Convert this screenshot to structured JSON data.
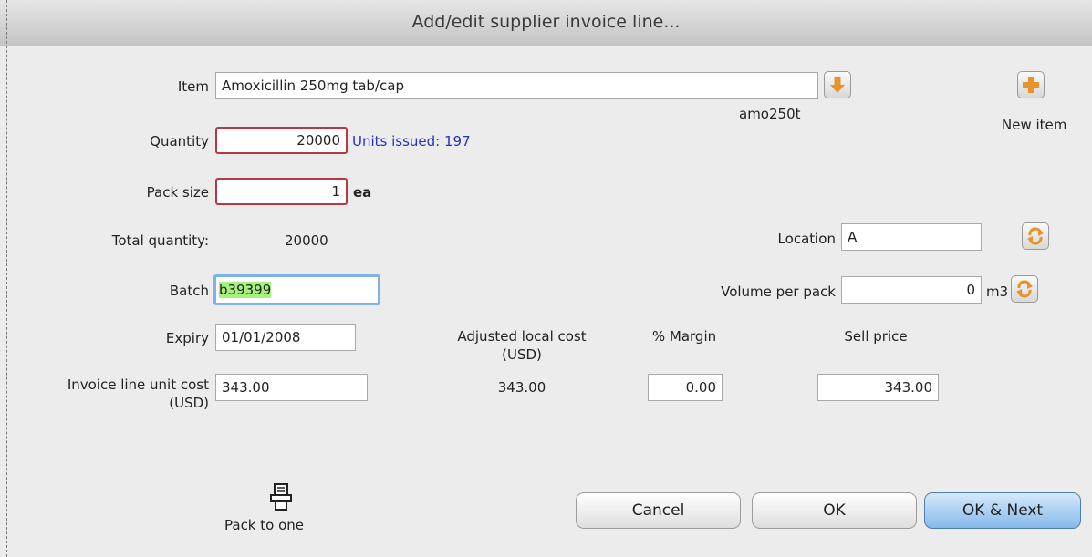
{
  "window": {
    "title": "Add/edit supplier invoice line..."
  },
  "item": {
    "label": "Item",
    "value": "Amoxicillin 250mg tab/cap",
    "code": "amo250t",
    "new_item_label": "New item",
    "dropdown_icon": "arrow-down-icon",
    "new_item_icon": "plus-icon"
  },
  "quantity": {
    "label": "Quantity",
    "value": "20000",
    "units_issued": "Units issued: 197"
  },
  "pack_size": {
    "label": "Pack size",
    "value": "1",
    "unit": "ea"
  },
  "total_quantity": {
    "label": "Total quantity:",
    "value": "20000"
  },
  "location": {
    "label": "Location",
    "value": "A",
    "icon": "cycle-icon"
  },
  "batch": {
    "label": "Batch",
    "value": "b39399"
  },
  "volume": {
    "label": "Volume per pack",
    "value": "0",
    "unit": "m3",
    "icon": "cycle-icon"
  },
  "expiry": {
    "label": "Expiry",
    "value": "01/01/2008"
  },
  "adjusted_cost": {
    "label": "Adjusted local cost",
    "sublabel": "(USD)",
    "value": "343.00"
  },
  "margin": {
    "label": "% Margin",
    "value": "0.00"
  },
  "sell_price": {
    "label": "Sell price",
    "value": "343.00"
  },
  "unit_cost": {
    "label": "Invoice line unit cost",
    "sublabel": "(USD)",
    "value": "343.00"
  },
  "pack_to_one": {
    "label": "Pack to one",
    "icon": "pack-icon"
  },
  "buttons": {
    "cancel": "Cancel",
    "ok": "OK",
    "ok_next": "OK & Next"
  },
  "colors": {
    "required_border": "#b33a42",
    "focus_border": "#7fb2e6",
    "highlight": "#a7f27a",
    "link_blue": "#2431c9",
    "icon_orange": "#e9922b",
    "primary_button": "#86b9ea"
  }
}
